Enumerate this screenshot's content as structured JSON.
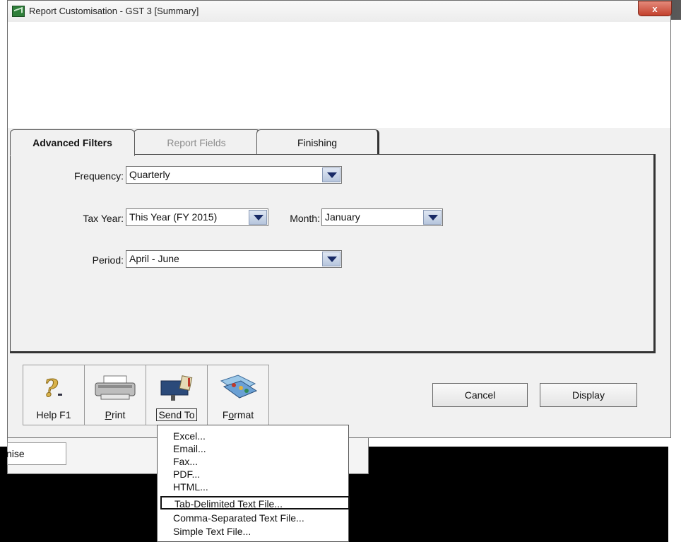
{
  "window": {
    "title": "Report Customisation - GST 3 [Summary]",
    "close_glyph": "x"
  },
  "tabs": [
    {
      "label": "Advanced Filters",
      "active": true
    },
    {
      "label": "Report Fields",
      "active": false
    },
    {
      "label": "Finishing",
      "active": false
    }
  ],
  "filters": {
    "frequency_label": "Frequency:",
    "frequency_value": "Quarterly",
    "tax_year_label": "Tax Year:",
    "tax_year_value": "This Year (FY 2015)",
    "month_label": "Month:",
    "month_value": "January",
    "period_label": "Period:",
    "period_value": "April - June"
  },
  "toolbar": {
    "help_label": "Help F1",
    "print_label": "Print",
    "send_to_label": "Send To",
    "format_label": "Format"
  },
  "buttons": {
    "cancel_label": "Cancel",
    "display_label": "Display"
  },
  "send_to_menu": {
    "items": [
      "Excel...",
      "Email...",
      "Fax...",
      "PDF...",
      "HTML...",
      "Tab-Delimited Text File...",
      "Comma-Separated Text File...",
      "Simple Text File..."
    ],
    "highlighted": "Tab-Delimited Text File..."
  },
  "background_window": {
    "field_text": "nise"
  },
  "icons": {
    "title": "report-app-icon",
    "help": "help-question-icon",
    "print": "printer-icon",
    "send_to": "mailbox-icon",
    "format": "format-palette-icon"
  },
  "colors": {
    "combo_arrow": "#182a66",
    "close_button": "#c3402c"
  }
}
